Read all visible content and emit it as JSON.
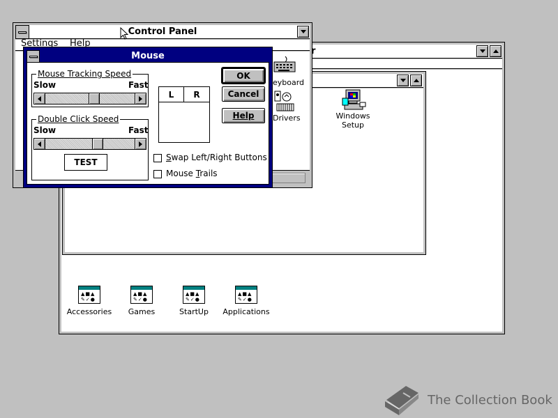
{
  "program_manager": {
    "title_fragment": "r",
    "groups": [
      {
        "label": "Accessories",
        "icon": "program-group-icon"
      },
      {
        "label": "Games",
        "icon": "program-group-icon"
      },
      {
        "label": "StartUp",
        "icon": "program-group-icon"
      },
      {
        "label": "Applications",
        "icon": "program-group-icon"
      }
    ]
  },
  "main_group": {
    "icons": [
      {
        "label_fragment": "eyboard",
        "icon": "keyboard-icon"
      },
      {
        "label_fragment": "Drivers",
        "icon": "drivers-icon"
      },
      {
        "label_fragment": "s",
        "icon": "partial-icon"
      },
      {
        "label": "Windows\nSetup",
        "label_line1": "Windows",
        "label_line2": "Setup",
        "icon": "windows-setup-icon"
      }
    ]
  },
  "control_panel": {
    "title": "Control Panel",
    "menu": [
      {
        "label": "Settings"
      },
      {
        "label": "Help"
      }
    ]
  },
  "mouse_dialog": {
    "title": "Mouse",
    "tracking": {
      "group_label": "Mouse Tracking Speed",
      "slow_label": "Slow",
      "fast_label": "Fast",
      "position": 0.55
    },
    "double_click": {
      "group_label": "Double Click Speed",
      "slow_label": "Slow",
      "fast_label": "Fast",
      "position": 0.6,
      "test_label": "TEST"
    },
    "mouse_diagram": {
      "left": "L",
      "right": "R"
    },
    "swap_label": "Swap Left/Right Buttons",
    "swap_checked": false,
    "trails_label": "Mouse Trails",
    "trails_checked": false,
    "buttons": {
      "ok": "OK",
      "cancel": "Cancel",
      "help": "Help"
    }
  },
  "watermark": {
    "text": "The Collection Book",
    "icon": "book-icon"
  },
  "colors": {
    "desktop": "#c0c0c0",
    "active_title": "#000080",
    "dialog_frame": "#000080"
  }
}
